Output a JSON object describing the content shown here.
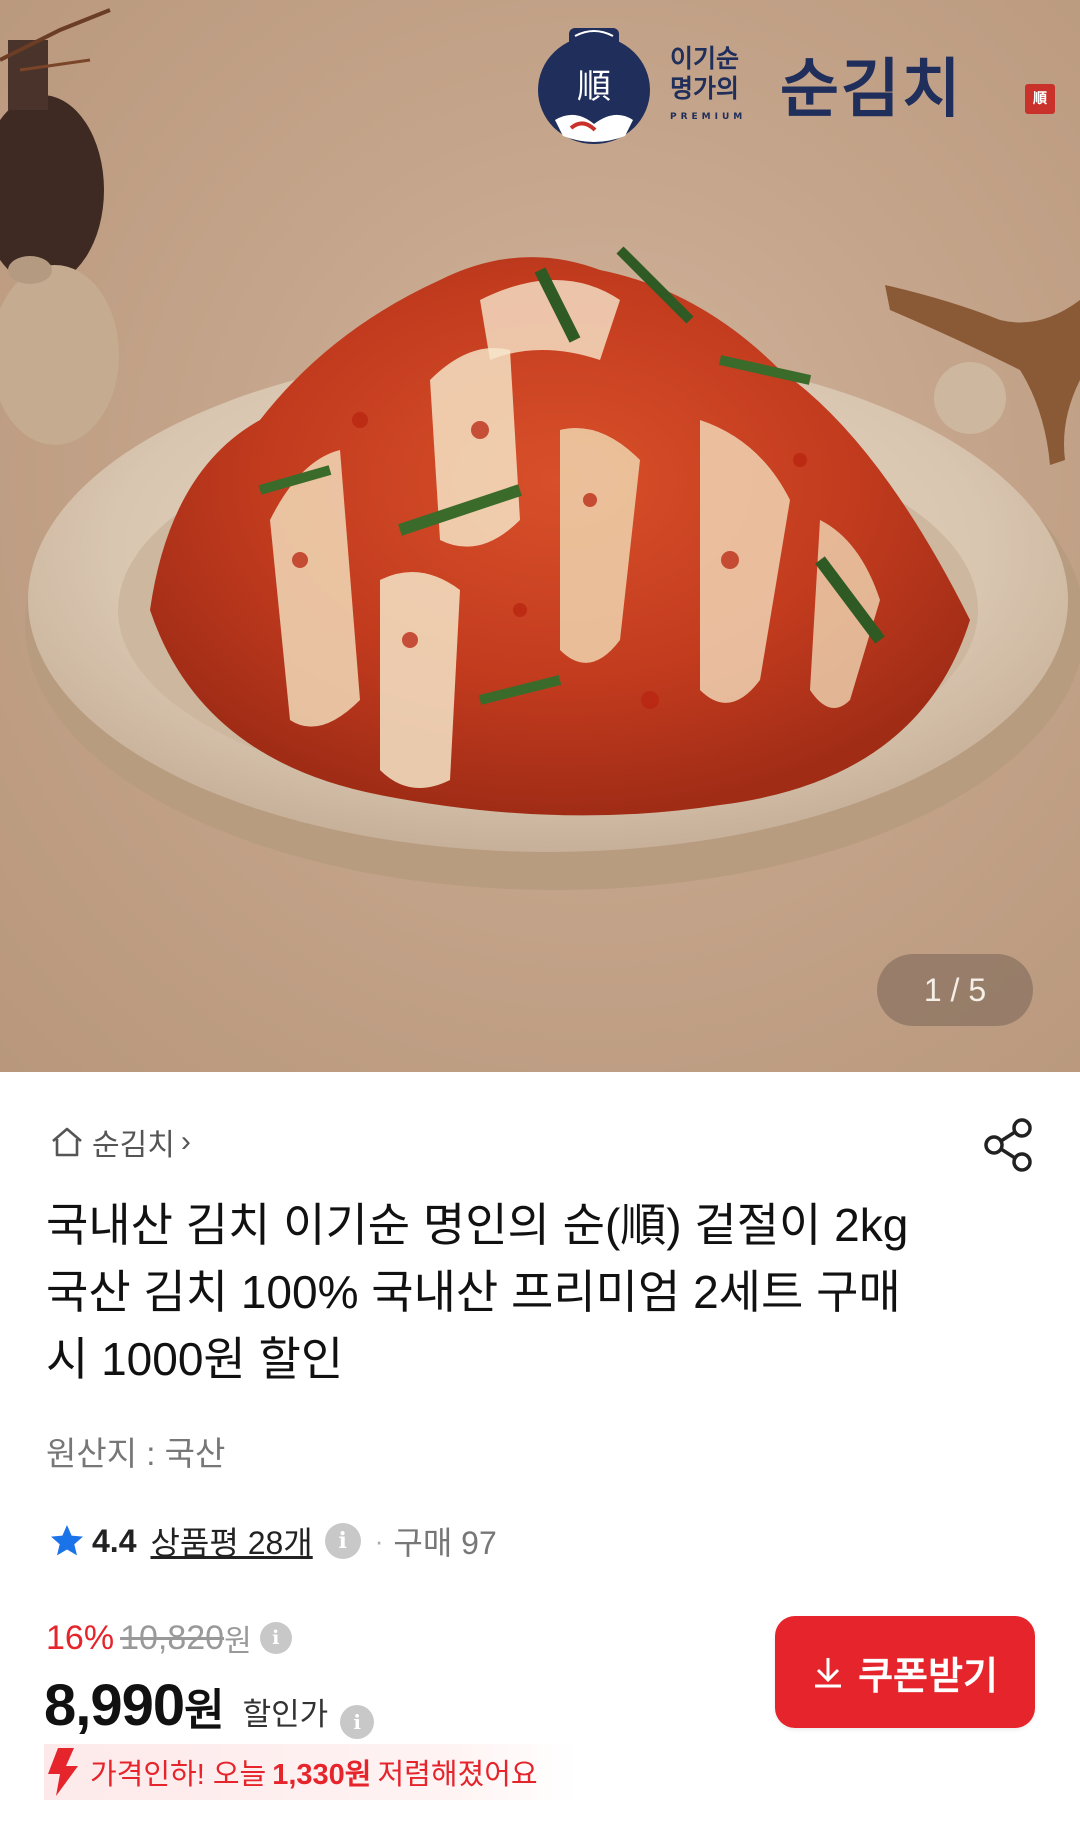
{
  "hero": {
    "brand_sub_line1": "이기순",
    "brand_sub_line2": "명가의",
    "brand_premium": "PREMIUM",
    "brand_main": "순김치",
    "brand_emblem_char": "順",
    "brand_seal_char": "順",
    "page_indicator": "1 / 5"
  },
  "store": {
    "name": "순김치",
    "chevron": "›",
    "icon": "home-icon"
  },
  "share_icon": "share-icon",
  "product": {
    "title": "국내산 김치 이기순 명인의 순(順) 겉절이 2kg 국산 김치 100% 국내산 프리미엄 2세트 구매 시 1000원 할인",
    "origin": "원산지 : 국산"
  },
  "rating": {
    "value": "4.4",
    "review_link": "상품평 28개",
    "separator": "·",
    "purchase": "구매 97",
    "star_color": "#1a73e8"
  },
  "price": {
    "discount_rate": "16%",
    "original_price": "10,820",
    "original_unit": "원",
    "sale_price": "8,990",
    "sale_unit": "원",
    "sale_label": "할인가",
    "info_glyph": "i"
  },
  "coupon": {
    "label": "쿠폰받기",
    "color": "#e5242b"
  },
  "price_drop": {
    "prefix": "가격인하! 오늘",
    "amount": "1,330원",
    "suffix": "저렴해졌어요",
    "icon": "price-drop-arrow-icon"
  }
}
